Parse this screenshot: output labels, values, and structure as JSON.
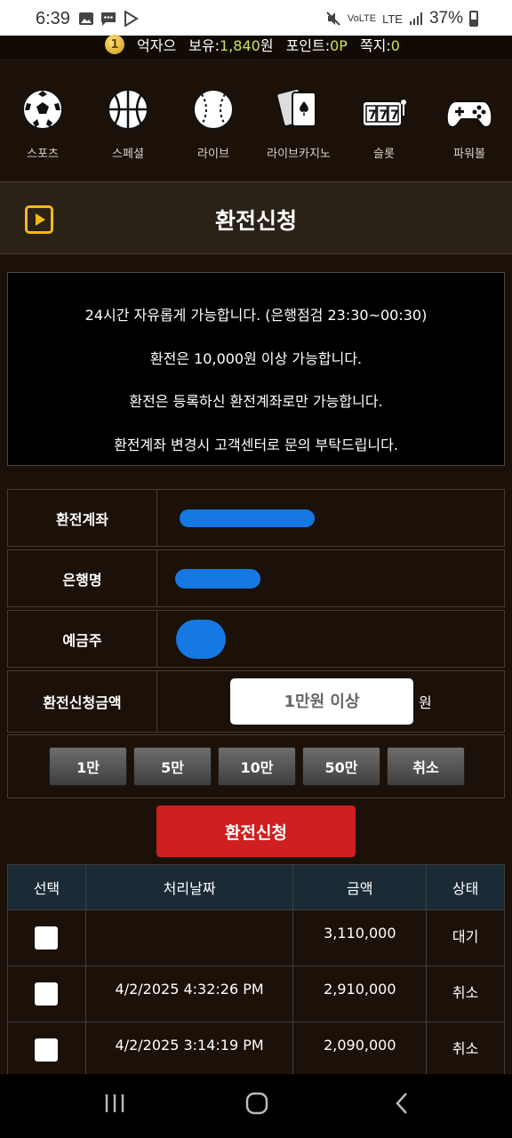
{
  "status_bar": {
    "time": "6:39",
    "network": "LTE",
    "volte": "VoLTE",
    "battery": "37%"
  },
  "user_bar": {
    "level": "1",
    "username": "억자으",
    "balance_label": "보유:",
    "balance_value": "1,840",
    "balance_unit": "원",
    "point_label": "포인트:",
    "point_value": "0P",
    "message_label": "쪽지:",
    "message_value": "0"
  },
  "categories": [
    {
      "label": "스포츠",
      "icon": "soccer-ball-icon"
    },
    {
      "label": "스페셜",
      "icon": "basketball-icon"
    },
    {
      "label": "라이브",
      "icon": "baseball-icon"
    },
    {
      "label": "라이브카지노",
      "icon": "playing-cards-icon"
    },
    {
      "label": "슬롯",
      "icon": "slot-machine-icon"
    },
    {
      "label": "파워볼",
      "icon": "gamepad-icon"
    }
  ],
  "page_title": "환전신청",
  "notice": [
    "24시간 자유롭게 가능합니다. (은행점검 23:30~00:30)",
    "환전은 10,000원 이상 가능합니다.",
    "환전은 등록하신 환전계좌로만 가능합니다.",
    "환전계좌 변경시 고객센터로 문의 부탁드립니다."
  ],
  "form": {
    "account_label": "환전계좌",
    "bank_label": "은행명",
    "holder_label": "예금주",
    "amount_label": "환전신청금액",
    "amount_placeholder": "1만원 이상",
    "amount_unit": "원"
  },
  "quick_buttons": [
    "1만",
    "5만",
    "10만",
    "50만",
    "취소"
  ],
  "submit_label": "환전신청",
  "table": {
    "headers": [
      "선택",
      "처리날짜",
      "금액",
      "상태"
    ],
    "rows": [
      {
        "date": "",
        "amount": "3,110,000",
        "status": "대기"
      },
      {
        "date": "4/2/2025 4:32:26 PM",
        "amount": "2,910,000",
        "status": "취소"
      },
      {
        "date": "4/2/2025 3:14:19 PM",
        "amount": "2,090,000",
        "status": "취소"
      }
    ]
  },
  "colors": {
    "background": "#1b1109",
    "accent_gold": "#f3b917",
    "submit_red": "#cf1f1f",
    "balance_green": "#c9e35d",
    "table_header": "#1b2b36",
    "redaction_blue": "#1678e3"
  }
}
